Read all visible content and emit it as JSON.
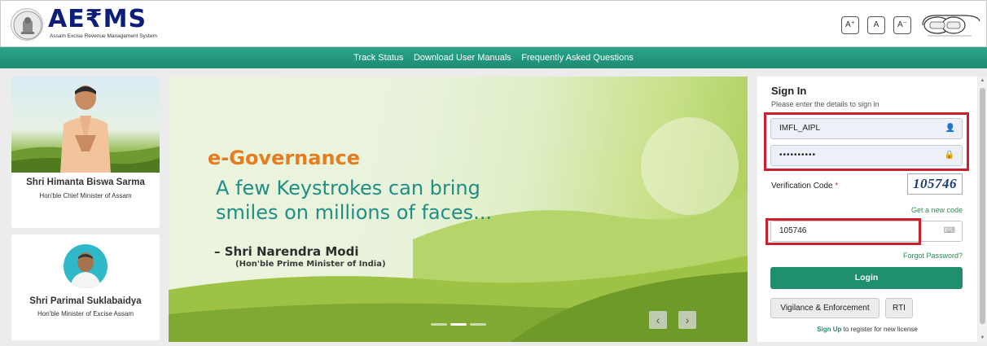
{
  "header": {
    "logo_text": "AE₹MS",
    "logo_subtitle": "Assam Excise Revenue Management System",
    "font_size_buttons": [
      "A⁺",
      "A",
      "A⁻"
    ],
    "language_toggle_icon": "language-toggle-icon"
  },
  "nav": {
    "items": [
      "Track Status",
      "Download User Manuals",
      "Frequently Asked Questions"
    ]
  },
  "cards": [
    {
      "name": "Shri Himanta Biswa Sarma",
      "title": "Hon'ble Chief Minister of Assam"
    },
    {
      "name": "Shri Parimal Suklabaidya",
      "title": "Hon'ble Minister of Excise Assam"
    }
  ],
  "banner": {
    "heading": "e-Governance",
    "quote_line1": "A few Keystrokes can bring",
    "quote_line2": "smiles on millions of faces...",
    "author": "– Shri Narendra Modi",
    "author_title": "(Hon'ble Prime Minister of India)",
    "slide_count": 3,
    "active_slide": 2,
    "prev_label": "‹",
    "next_label": "›"
  },
  "signin": {
    "title": "Sign In",
    "subtitle": "Please enter the details to sign in",
    "username_value": "IMFL_AIPL",
    "password_value": "••••••••••",
    "verification_label": "Verification Code",
    "required_marker": "*",
    "captcha_text": "105746",
    "get_new_code": "Get a new code",
    "code_value": "105746",
    "forgot_password": "Forgot Password?",
    "login_label": "Login",
    "vigilance_label": "Vigilance & Enforcement",
    "rti_label": "RTI",
    "signup_link": "Sign Up",
    "signup_text": "to register for new license"
  },
  "colors": {
    "nav_green": "#1e8a72",
    "highlight_red": "#cc1f2d",
    "logo_navy": "#0c1e7a",
    "accent_orange": "#e57c1f",
    "quote_teal": "#1f8f86"
  }
}
